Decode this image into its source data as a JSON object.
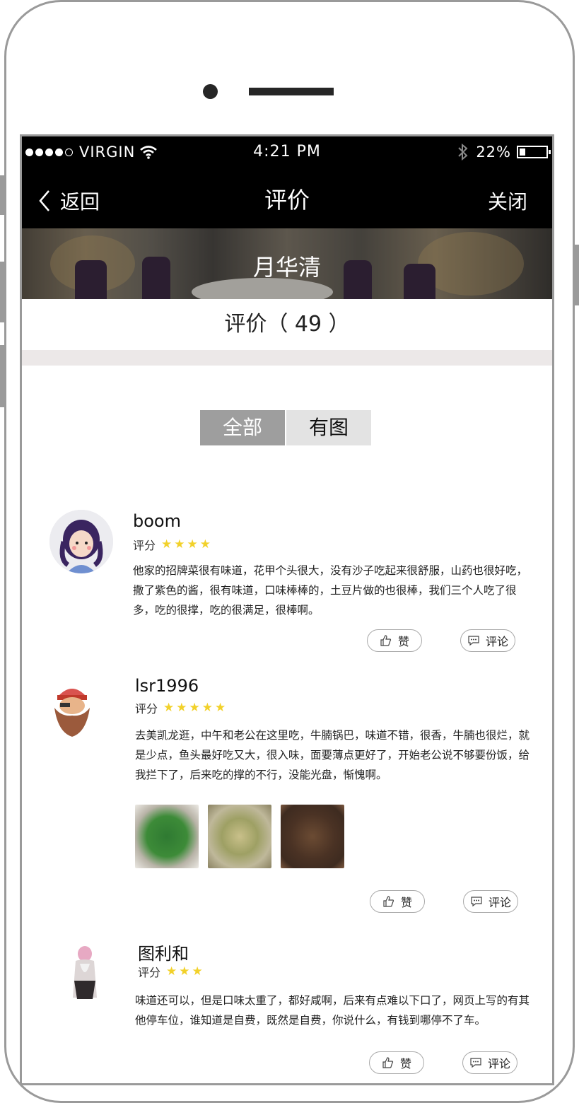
{
  "status_bar": {
    "carrier": "VIRGIN",
    "time": "4:21 PM",
    "battery": "22%",
    "battery_level": 0.22,
    "icons": [
      "signal-dots-icon",
      "wifi-icon",
      "bluetooth-icon",
      "battery-icon"
    ]
  },
  "nav": {
    "back_label": "返回",
    "title": "评价",
    "close_label": "关闭"
  },
  "restaurant": {
    "name": "月华清"
  },
  "summary": {
    "label": "评价（ 49 ）"
  },
  "tabs": [
    {
      "label": "全部",
      "active": true
    },
    {
      "label": "有图",
      "active": false
    }
  ],
  "reviews": [
    {
      "user": "boom",
      "score_label": "评分",
      "stars": 4,
      "text": "他家的招牌菜很有味道，花甲个头很大，没有沙子吃起来很舒服，山药也很好吃，撒了紫色的酱，很有味道，口味棒棒的，土豆片做的也很棒，我们三个人吃了很多，吃的很撑，吃的很满足，很棒啊。",
      "like_label": "赞",
      "comment_label": "评论",
      "photos": 0
    },
    {
      "user": "lsr1996",
      "score_label": "评分",
      "stars": 5,
      "text": "去美凯龙逛，中午和老公在这里吃，牛腩锅巴，味道不错，很香，牛腩也很烂，就是少点，鱼头最好吃又大，很入味，面要薄点更好了，开始老公说不够要份饭，给我拦下了，后来吃的撑的不行，没能光盘，惭愧啊。",
      "like_label": "赞",
      "comment_label": "评论",
      "photos": 3
    },
    {
      "user": "图利和",
      "score_label": "评分",
      "stars": 3,
      "text": "味道还可以，但是口味太重了，都好咸啊，后来有点难以下口了，网页上写的有其他停车位，谁知道是自费，既然是自费，你说什么，有钱到哪停不了车。",
      "like_label": "赞",
      "comment_label": "评论",
      "photos": 0
    }
  ],
  "colors": {
    "nav_bg": "#000000",
    "tab_active_bg": "#9e9e9e",
    "tab_inactive_bg": "#e3e3e3",
    "star": "#f2d12a",
    "divider": "#ece8e8"
  }
}
